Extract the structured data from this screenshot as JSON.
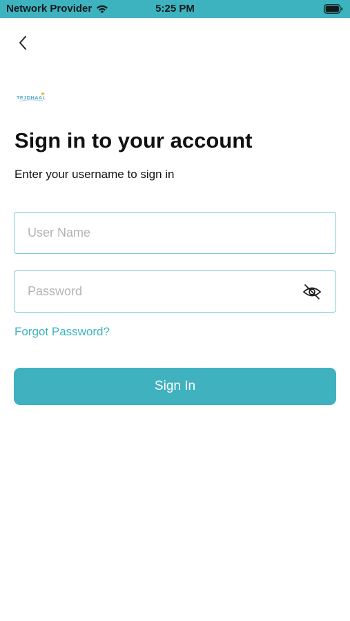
{
  "status_bar": {
    "carrier": "Network Provider",
    "time": "5:25 PM",
    "wifi_icon": "wifi-icon",
    "battery_icon": "battery-icon"
  },
  "nav": {
    "back_icon": "chevron-left-icon"
  },
  "brand": {
    "logo_text": "TEJDHAAL"
  },
  "header": {
    "title": "Sign in to your account",
    "subtitle": "Enter your username to sign in"
  },
  "form": {
    "username_placeholder": "User Name",
    "username_value": "",
    "password_placeholder": "Password",
    "password_value": "",
    "password_toggle_icon": "eye-off-icon",
    "forgot_password": "Forgot Password?",
    "sign_in": "Sign In"
  },
  "colors": {
    "accent": "#3eb3c0",
    "field_border": "#7cc9d3",
    "placeholder": "#b3b3b3",
    "text": "#111111",
    "button_text": "#ffffff"
  }
}
